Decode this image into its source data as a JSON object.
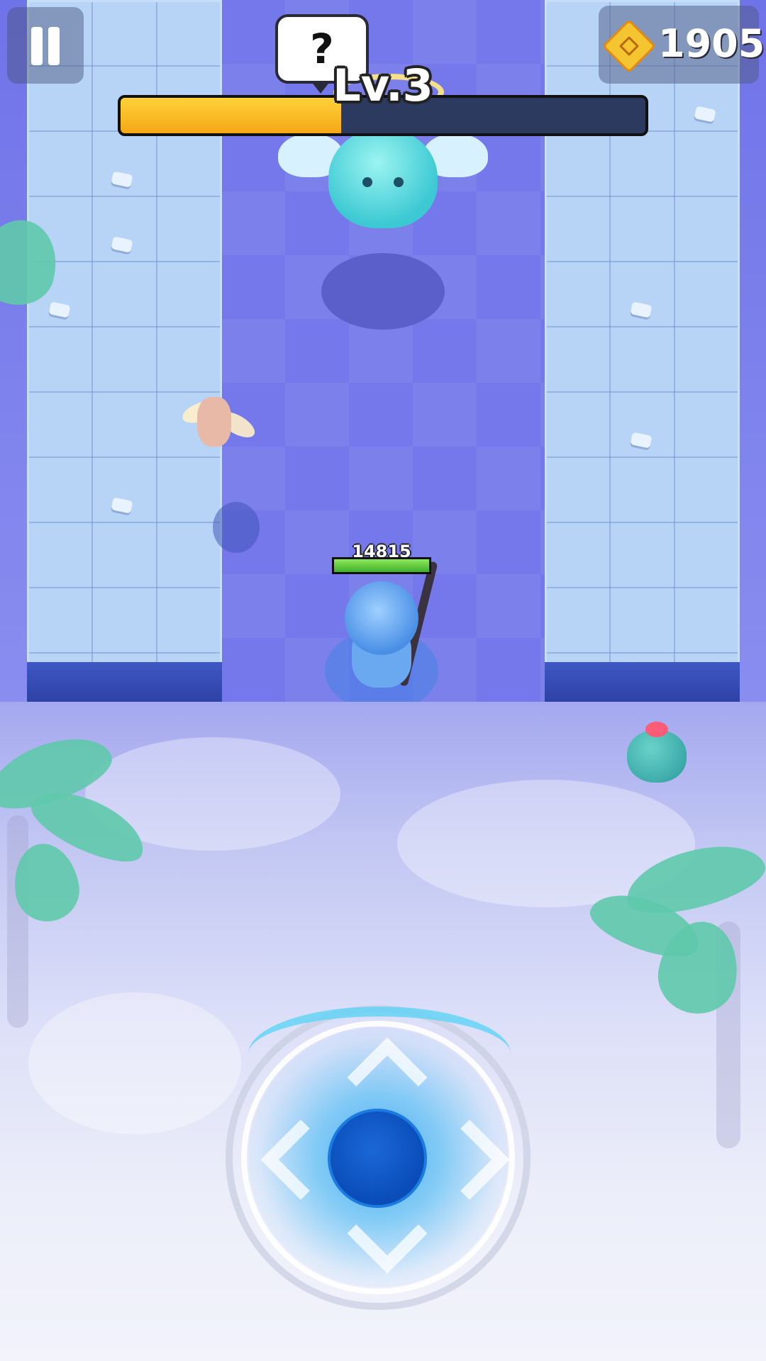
{
  "hud": {
    "level_label": "Lv.3",
    "xp_progress": 0.42,
    "currency_value": "1905",
    "currency_icon": "arrow-gem-icon",
    "question_label": "?",
    "pause_icon": "pause-icon"
  },
  "player": {
    "hp_value": "14815",
    "hp_fraction": 1.0
  },
  "colors": {
    "xp_fill": "#f5b21f",
    "hp_fill": "#5ccc3a",
    "joystick_knob": "#0a4cb8",
    "corridor": "#7478ea",
    "wall_tile": "#b7d4f6"
  }
}
